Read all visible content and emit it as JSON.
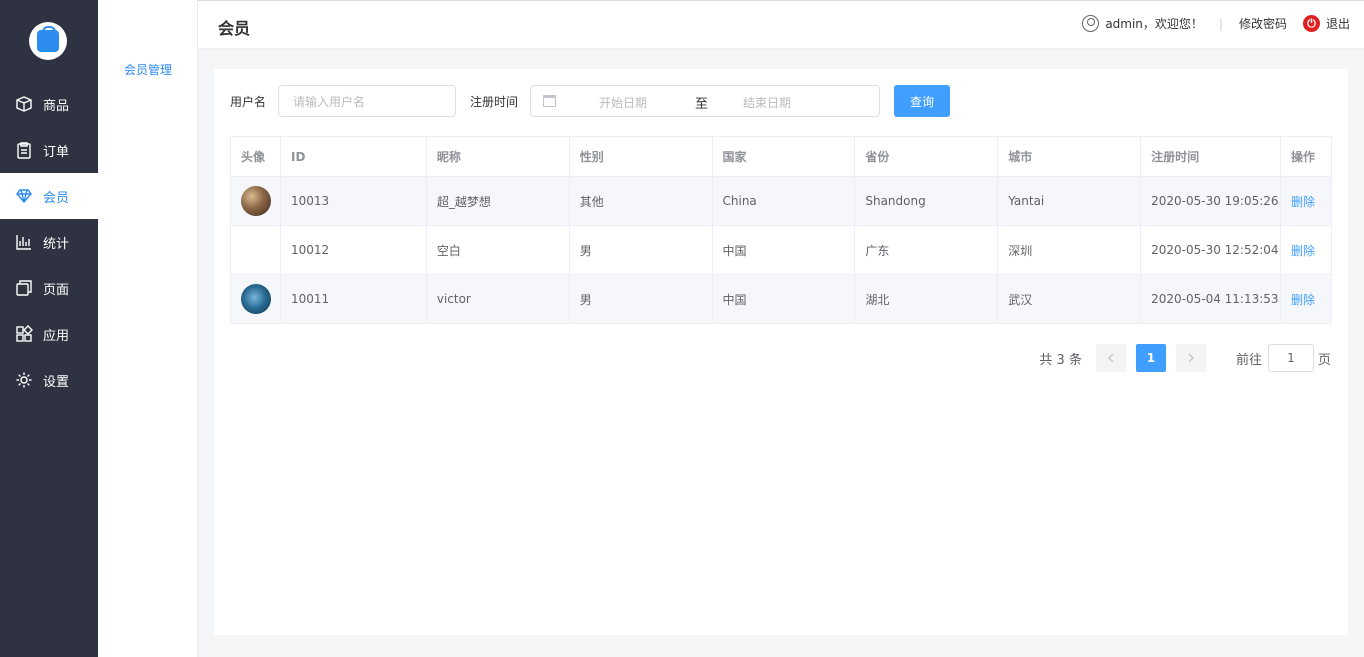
{
  "sidebar": {
    "items": [
      {
        "label": "商品",
        "icon": "box-icon"
      },
      {
        "label": "订单",
        "icon": "clipboard-icon"
      },
      {
        "label": "会员",
        "icon": "diamond-icon"
      },
      {
        "label": "统计",
        "icon": "bar-chart-icon"
      },
      {
        "label": "页面",
        "icon": "pages-icon"
      },
      {
        "label": "应用",
        "icon": "apps-grid-icon"
      },
      {
        "label": "设置",
        "icon": "gear-icon"
      }
    ]
  },
  "subnav": {
    "item": "会员管理"
  },
  "header": {
    "title": "会员",
    "welcome": "admin，欢迎您！",
    "sep": "|",
    "change_password": "修改密码",
    "logout": "退出"
  },
  "filters": {
    "username_label": "用户名",
    "username_placeholder": "请输入用户名",
    "regtime_label": "注册时间",
    "start_placeholder": "开始日期",
    "range_sep": "至",
    "end_placeholder": "结束日期",
    "query_label": "查询"
  },
  "table": {
    "columns": [
      "头像",
      "ID",
      "昵称",
      "性别",
      "国家",
      "省份",
      "城市",
      "注册时间",
      "操作"
    ],
    "rows": [
      {
        "avatar": "photo",
        "id": "10013",
        "nickname": "超_越梦想",
        "gender": "其他",
        "country": "China",
        "province": "Shandong",
        "city": "Yantai",
        "regtime": "2020-05-30 19:05:26",
        "action": "删除"
      },
      {
        "avatar": "",
        "id": "10012",
        "nickname": "空白",
        "gender": "男",
        "country": "中国",
        "province": "广东",
        "city": "深圳",
        "regtime": "2020-05-30 12:52:04",
        "action": "删除"
      },
      {
        "avatar": "photo",
        "id": "10011",
        "nickname": "victor",
        "gender": "男",
        "country": "中国",
        "province": "湖北",
        "city": "武汉",
        "regtime": "2020-05-04 11:13:53",
        "action": "删除"
      }
    ]
  },
  "pagination": {
    "total_text": "共 3 条",
    "current_page": "1",
    "goto_label": "前往",
    "goto_value": "1",
    "page_suffix": "页"
  },
  "colors": {
    "accent": "#409eff",
    "sidebar_bg": "#2f3341",
    "logout_red": "#e02020"
  }
}
